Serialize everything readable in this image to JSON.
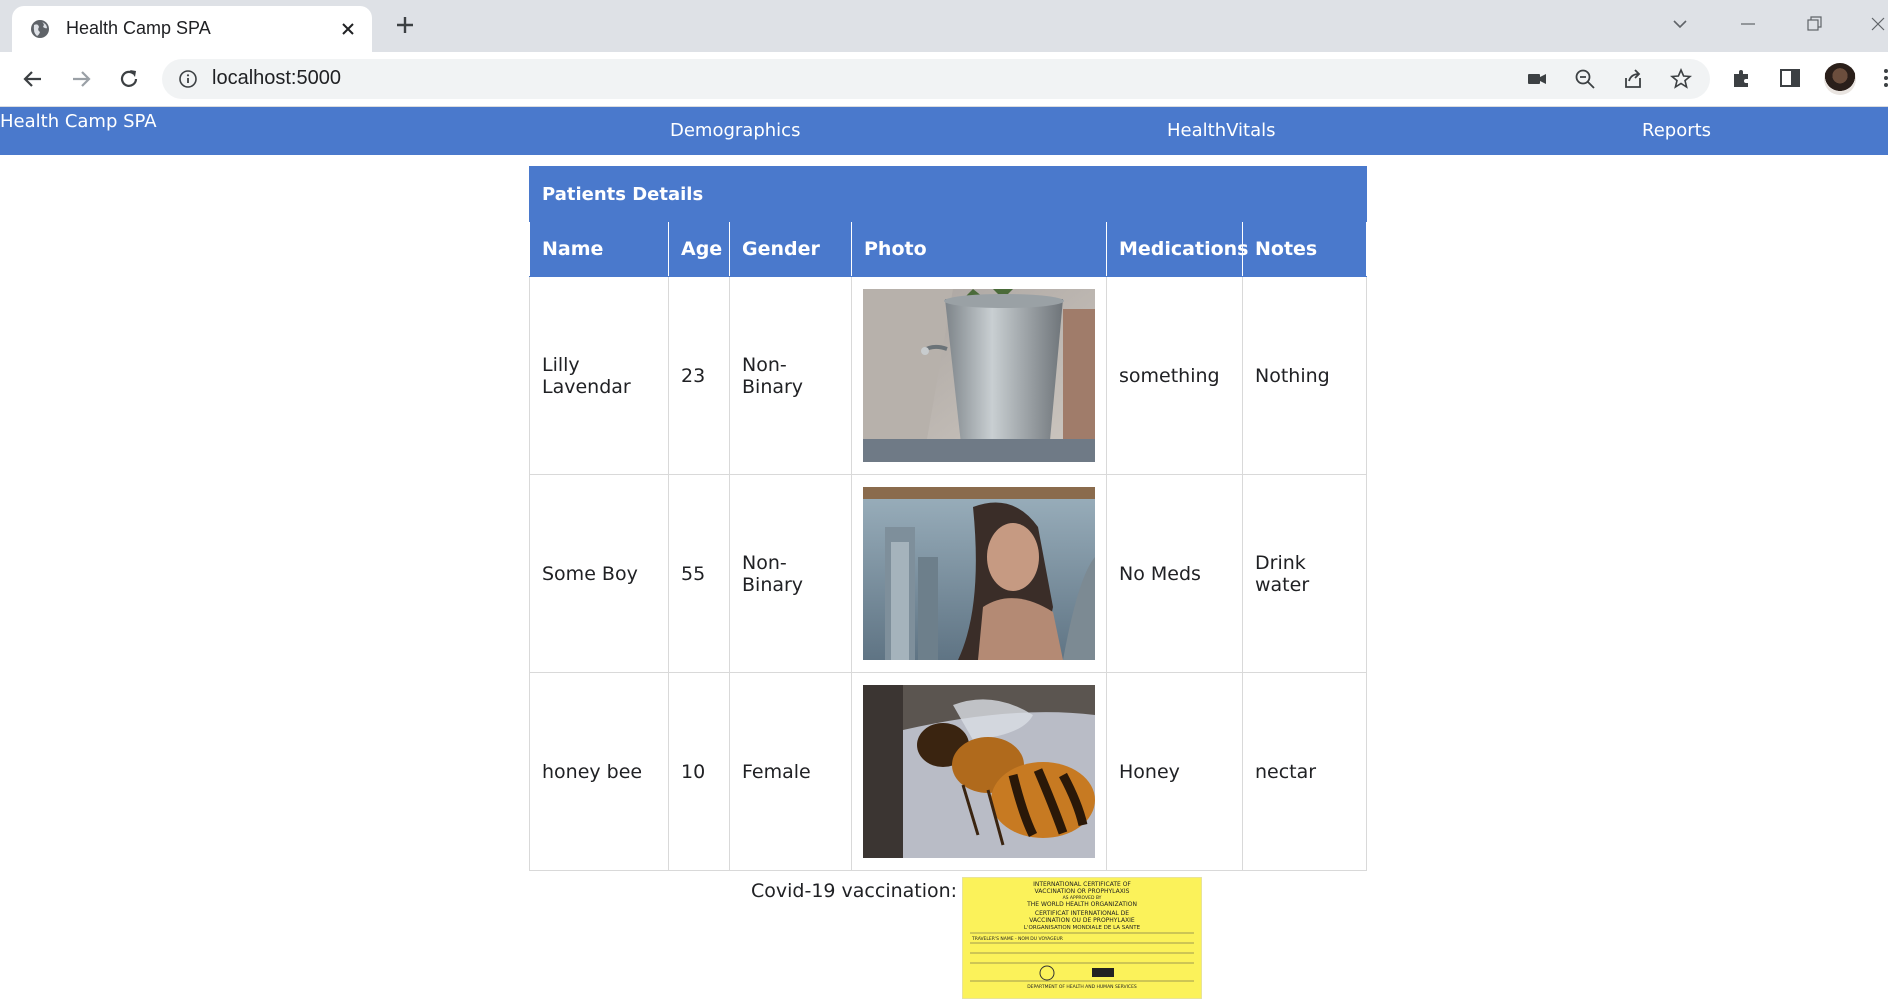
{
  "browser": {
    "tab_title": "Health Camp SPA",
    "url": "localhost:5000"
  },
  "app": {
    "brand": "Health Camp SPA",
    "nav": [
      "Demographics",
      "HealthVitals",
      "Reports"
    ]
  },
  "table": {
    "caption": "Patients Details",
    "columns": [
      "Name",
      "Age",
      "Gender",
      "Photo",
      "Medications",
      "Notes"
    ],
    "rows": [
      {
        "name": "Lilly Lavendar",
        "age": "23",
        "gender": "Non-Binary",
        "photo": "metal-bucket-photo",
        "medications": "something",
        "notes": "Nothing"
      },
      {
        "name": "Some Boy",
        "age": "55",
        "gender": "Non-Binary",
        "photo": "woman-poster-photo",
        "medications": "No Meds",
        "notes": "Drink water"
      },
      {
        "name": "honey bee",
        "age": "10",
        "gender": "Female",
        "photo": "honey-bee-photo",
        "medications": "Honey",
        "notes": "nectar"
      }
    ]
  },
  "vaccination": {
    "label": "Covid-19 vaccination:",
    "card_lines": [
      "INTERNATIONAL CERTIFICATE OF",
      "VACCINATION OR PROPHYLAXIS",
      "AS APPROVED BY",
      "THE WORLD HEALTH ORGANIZATION",
      "CERTIFICAT INTERNATIONAL DE",
      "VACCINATION OU DE PROPHYLAXIE",
      "L'ORGANISATION MONDIALE DE LA SANTE",
      "TRAVELER'S NAME - NOM DU VOYAGEUR",
      "DEPARTMENT OF HEALTH AND HUMAN SERVICES"
    ]
  },
  "colors": {
    "primary": "#4a79cc",
    "chrome": "#dee1e6",
    "cert_yellow": "#fbf25a"
  }
}
